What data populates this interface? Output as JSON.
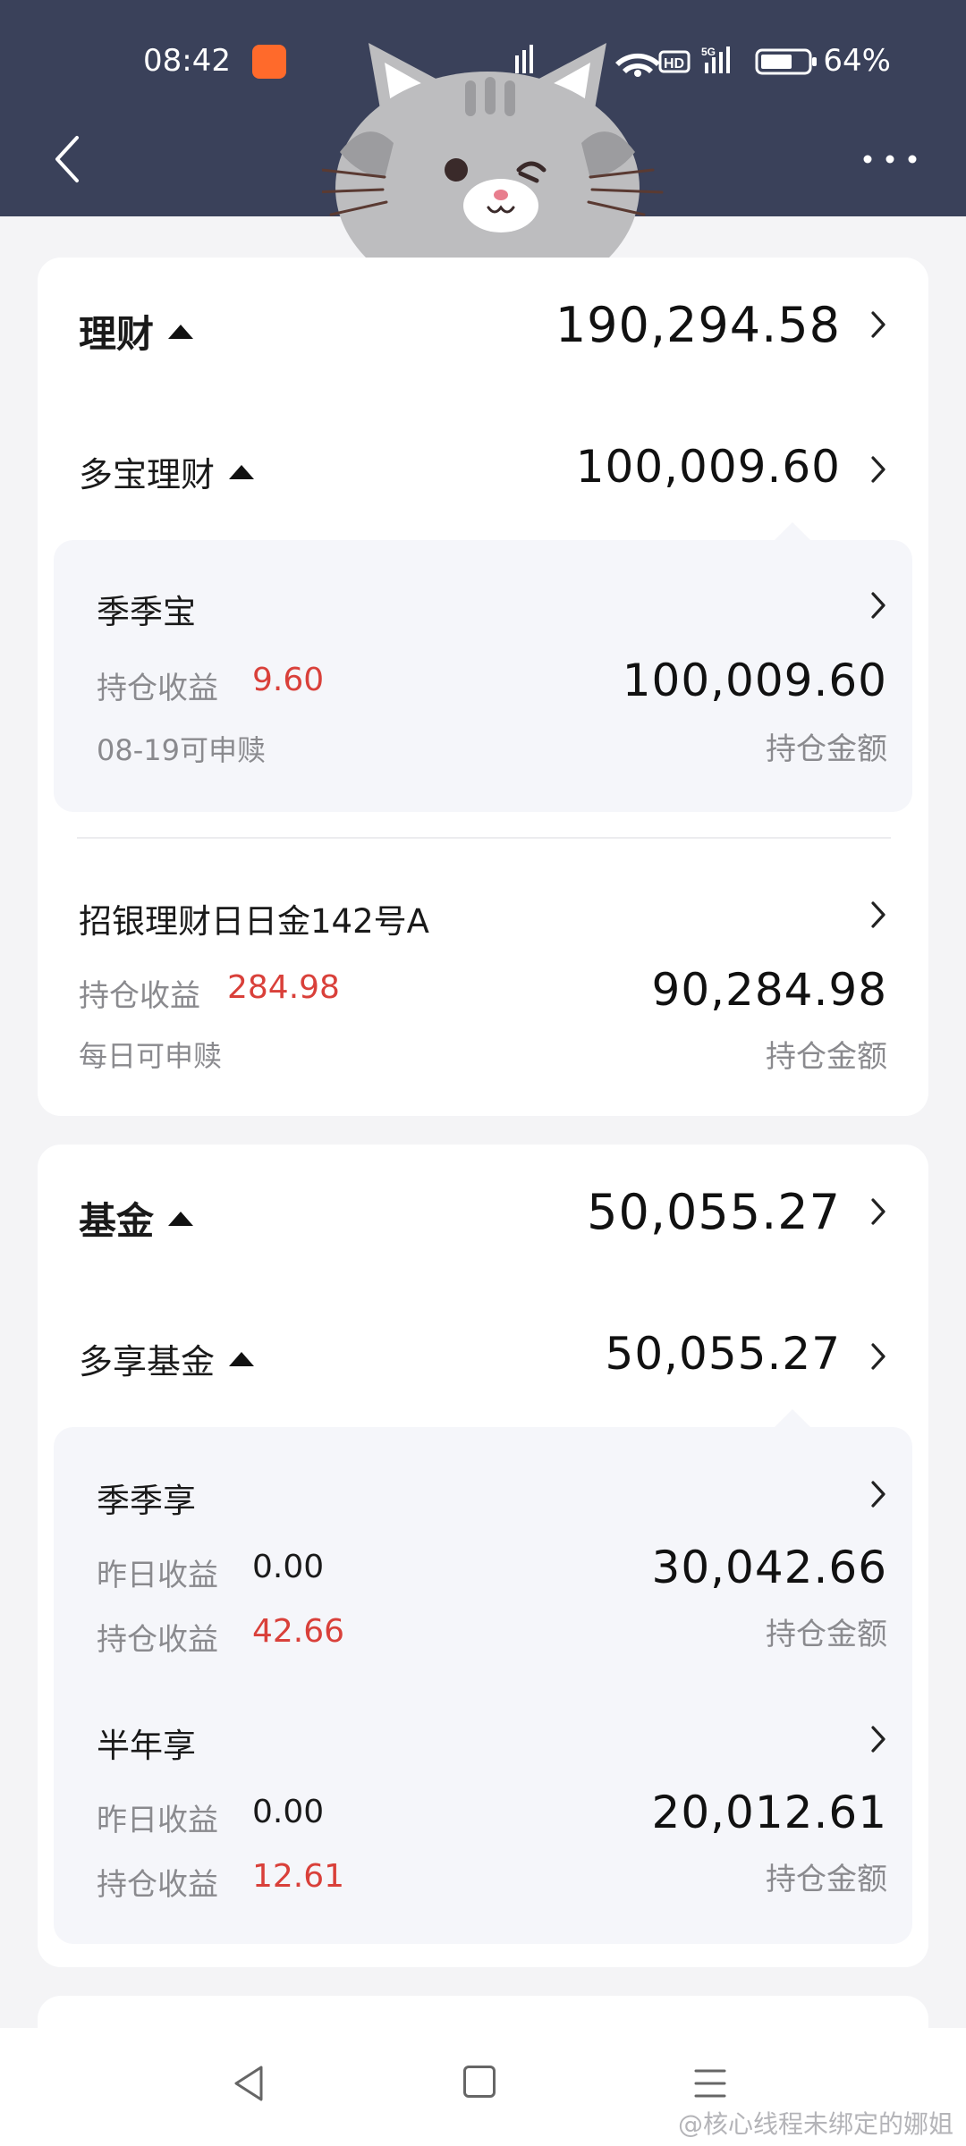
{
  "status_bar": {
    "time": "08:42",
    "battery": "64%",
    "network_badges": [
      "HD",
      "5G"
    ]
  },
  "header": {
    "back_icon": "chevron-left-icon",
    "more_icon": "more-dots-icon",
    "more_label": "···"
  },
  "wealth": {
    "title": "理财",
    "total": "190,294.58",
    "group": {
      "title": "多宝理财",
      "total": "100,009.60"
    },
    "products": [
      {
        "name": "季季宝",
        "profit_label": "持仓收益",
        "profit": "9.60",
        "note": "08-19可申赎",
        "hold_amount": "100,009.60",
        "hold_label": "持仓金额"
      },
      {
        "name": "招银理财日日金142号A",
        "profit_label": "持仓收益",
        "profit": "284.98",
        "note": "每日可申赎",
        "hold_amount": "90,284.98",
        "hold_label": "持仓金额"
      }
    ]
  },
  "fund": {
    "title": "基金",
    "total": "50,055.27",
    "group": {
      "title": "多享基金",
      "total": "50,055.27"
    },
    "products": [
      {
        "name": "季季享",
        "yesterday_label": "昨日收益",
        "yesterday": "0.00",
        "profit_label": "持仓收益",
        "profit": "42.66",
        "hold_amount": "30,042.66",
        "hold_label": "持仓金额"
      },
      {
        "name": "半年享",
        "yesterday_label": "昨日收益",
        "yesterday": "0.00",
        "profit_label": "持仓收益",
        "profit": "12.61",
        "hold_amount": "20,012.61",
        "hold_label": "持仓金额"
      }
    ]
  },
  "watermark": "@核心线程未绑定的娜姐",
  "colors": {
    "header_bg": "#3a415a",
    "profit_red": "#d9403a",
    "page_bg": "#f4f4f6",
    "panel_bg": "#f5f6fa"
  }
}
